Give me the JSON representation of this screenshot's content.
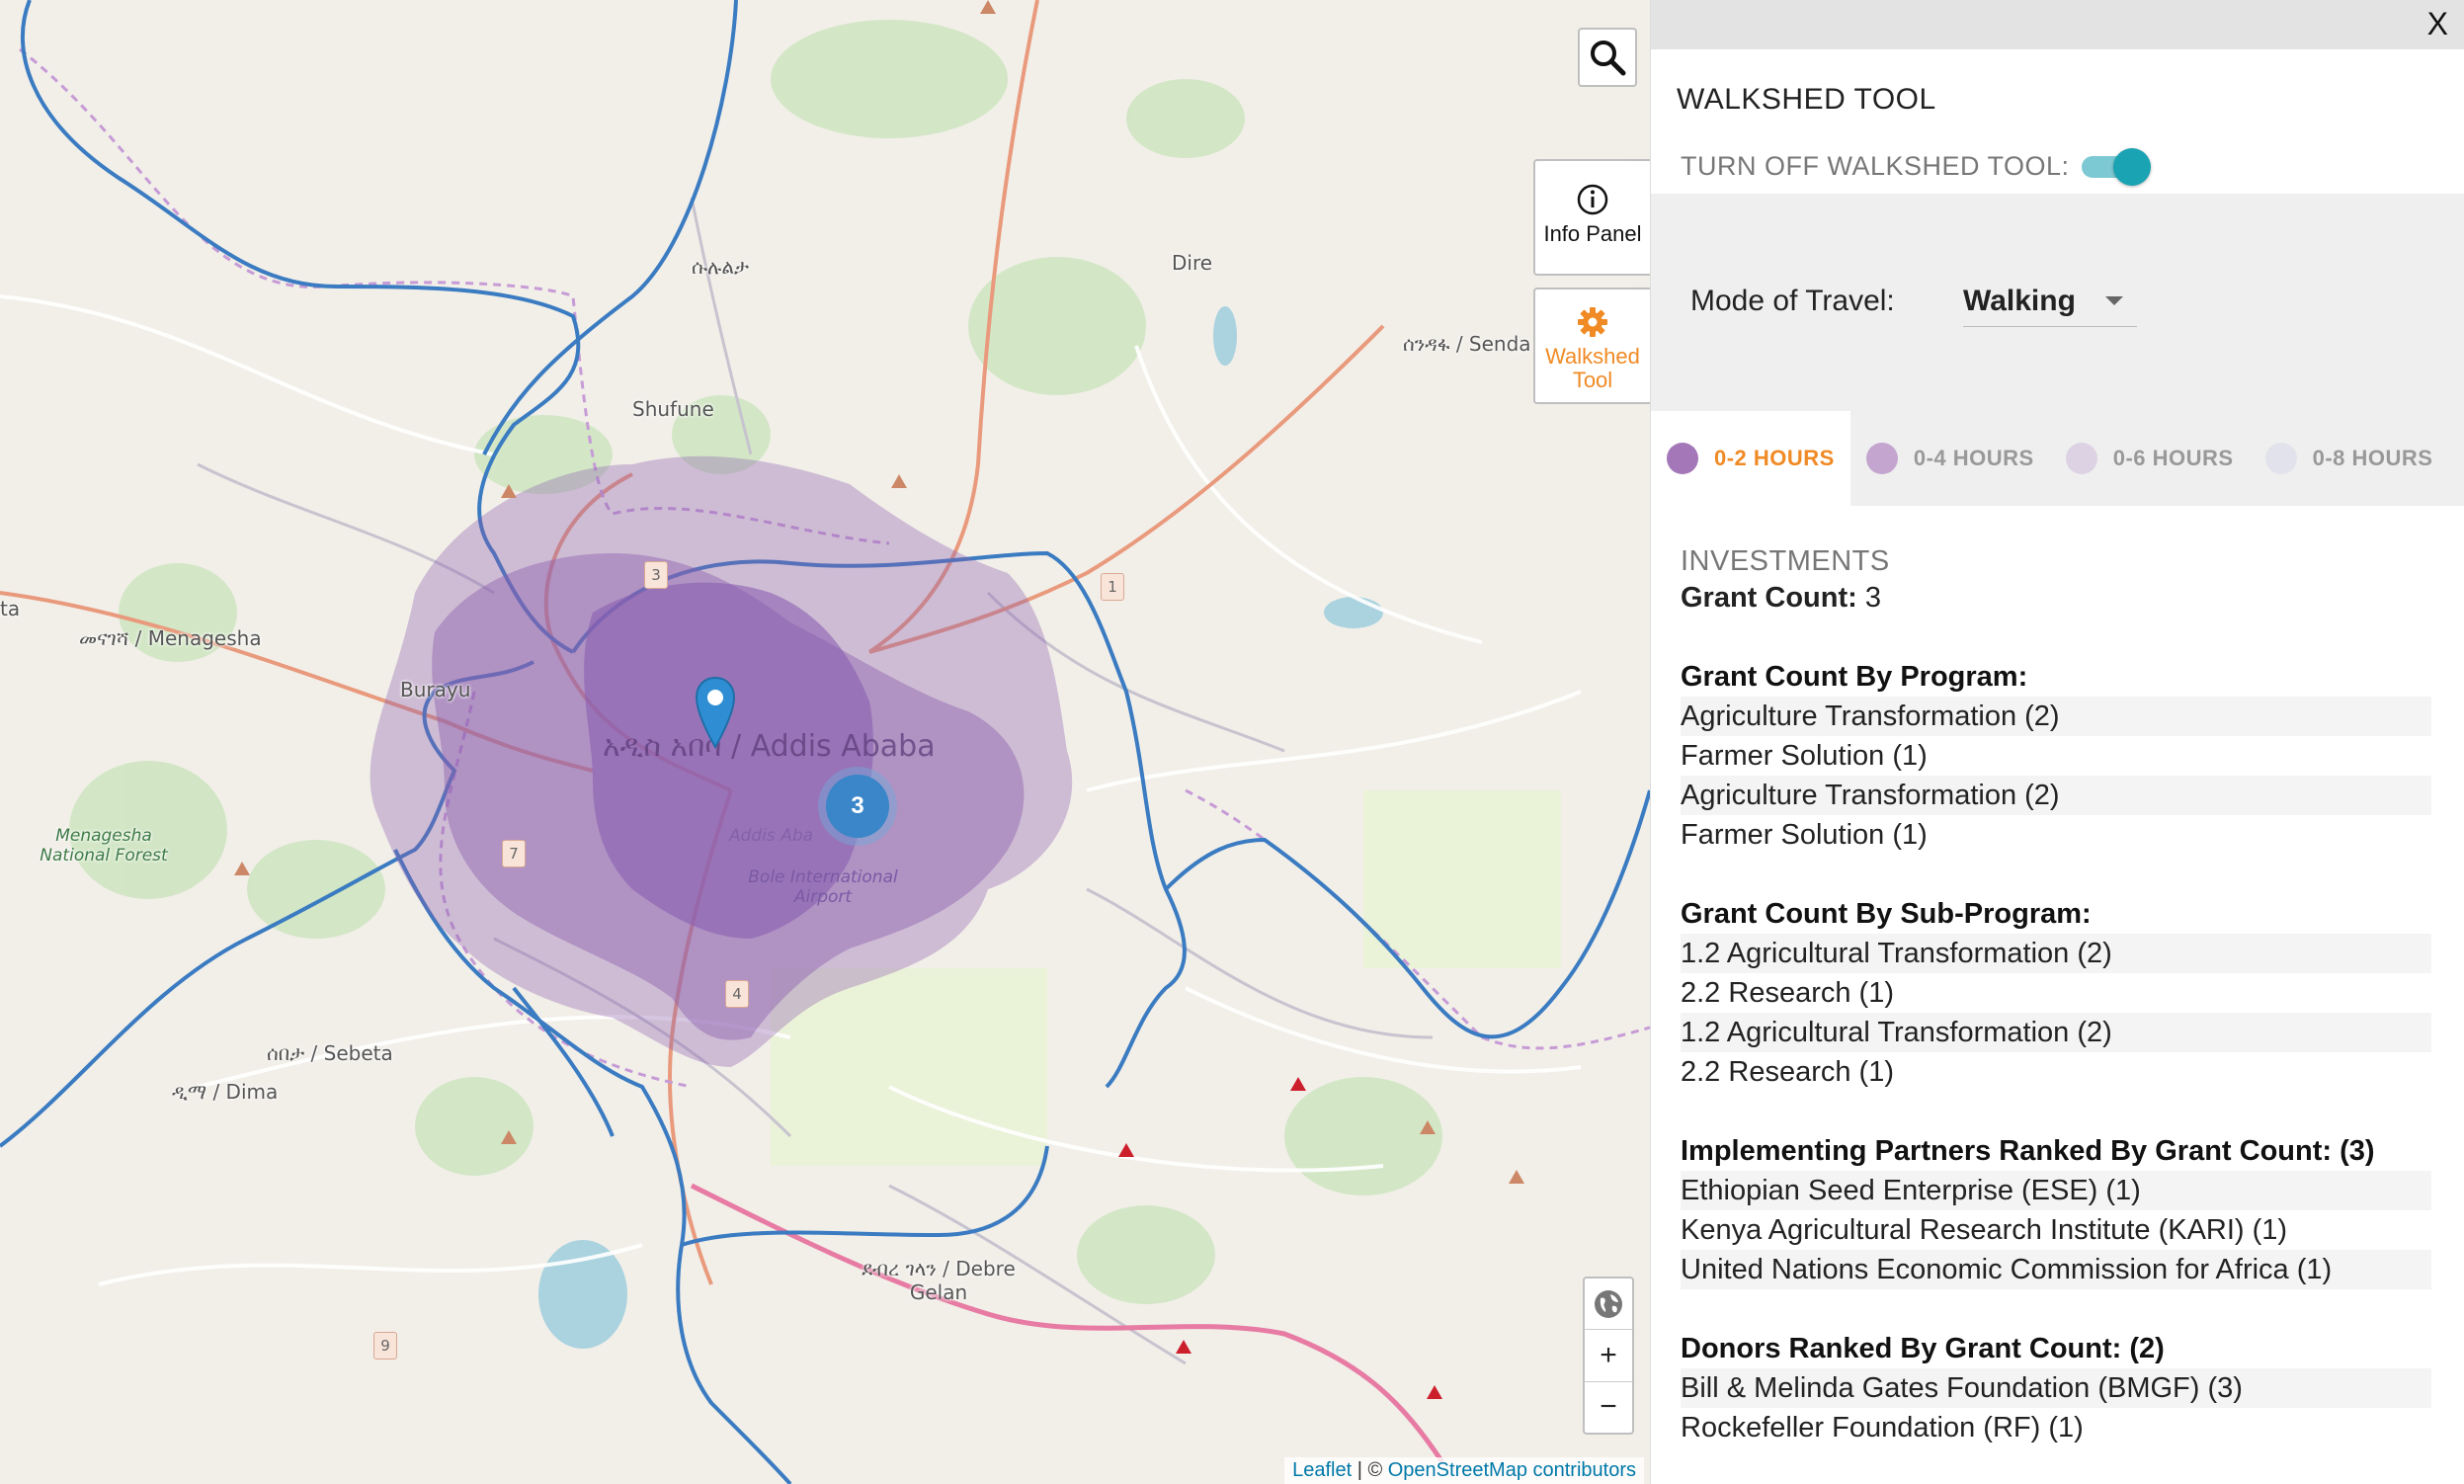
{
  "map": {
    "labels": {
      "menagesha": "መናገሻ / Menagesha",
      "burayu": "Burayu",
      "shufune": "Shufune",
      "dire": "Dire",
      "sululta": "ሱሉልታ",
      "sendafa": "ሰንዳፋ / Senda",
      "menagesha_forest": "Menagesha National Forest",
      "addis_ababa": "አዲስ አበባ / Addis Ababa",
      "addis_small": "Addis Aba",
      "airport": "Bole International Airport",
      "sebeta": "ሰበታ / Sebeta",
      "dima": "ዲማ / Dima",
      "debre_gelan": "ደብረ ገላን / Debre Gelan",
      "ta": "ta"
    },
    "road_shields": [
      "3",
      "1",
      "7",
      "4",
      "9"
    ],
    "cluster_count": "3",
    "marker_icon": "map-pin-icon",
    "isochrone_color": "#8b5fb0",
    "attribution": {
      "leaflet": "Leaflet",
      "separator": " | © ",
      "osm": "OpenStreetMap contributors"
    }
  },
  "controls": {
    "search_icon": "search-icon",
    "info_panel_label": "Info Panel",
    "info_icon": "info-icon",
    "walkshed_label_1": "Walkshed",
    "walkshed_label_2": "Tool",
    "walkshed_icon": "gear-icon",
    "layers_icon": "globe-icon",
    "zoom_in": "+",
    "zoom_out": "−"
  },
  "panel": {
    "close": "X",
    "title": "WALKSHED TOOL",
    "toggle_label": "TURN OFF WALKSHED TOOL:",
    "toggle_on": true,
    "mode_label": "Mode of Travel:",
    "mode_value": "Walking",
    "hours_tabs": [
      {
        "label": "0-2 HOURS",
        "color": "#a478b8",
        "active": true
      },
      {
        "label": "0-4 HOURS",
        "color": "#c3a5cf",
        "active": false
      },
      {
        "label": "0-6 HOURS",
        "color": "#dcd2e4",
        "active": false
      },
      {
        "label": "0-8 HOURS",
        "color": "#e2e2ec",
        "active": false
      }
    ],
    "investments_heading": "INVESTMENTS",
    "grant_count_label": "Grant Count:",
    "grant_count_value": "3",
    "by_program_title": "Grant Count By Program:",
    "by_program": [
      "Agriculture Transformation (2)",
      "Farmer Solution (1)",
      "Agriculture Transformation (2)",
      "Farmer Solution (1)"
    ],
    "by_subprogram_title": "Grant Count By Sub-Program:",
    "by_subprogram": [
      "1.2 Agricultural Transformation (2)",
      "2.2 Research (1)",
      "1.2 Agricultural Transformation (2)",
      "2.2 Research (1)"
    ],
    "partners_title": "Implementing Partners Ranked By Grant Count: (3)",
    "partners": [
      "Ethiopian Seed Enterprise (ESE) (1)",
      "Kenya Agricultural Research Institute (KARI) (1)",
      "United Nations Economic Commission for Africa (1)"
    ],
    "donors_title": "Donors Ranked By Grant Count: (2)",
    "donors": [
      "Bill & Melinda Gates Foundation (BMGF) (3)",
      "Rockefeller Foundation (RF) (1)"
    ]
  }
}
